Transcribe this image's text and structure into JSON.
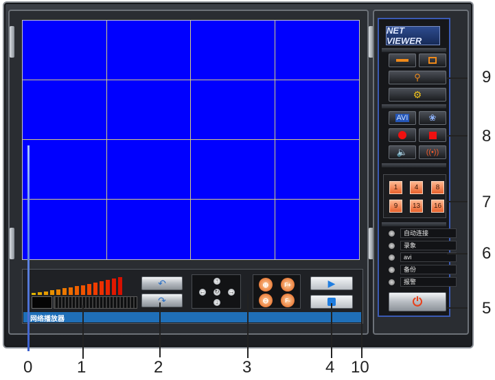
{
  "app": {
    "logo_text": "NET VIEWER",
    "status_bar_text": "网络播放器"
  },
  "status_panel": [
    {
      "label": "自动连接"
    },
    {
      "label": "录象"
    },
    {
      "label": "avi"
    },
    {
      "label": "备份"
    },
    {
      "label": "报警"
    }
  ],
  "channels": [
    "1",
    "4",
    "8",
    "9",
    "13",
    "16"
  ],
  "record_buttons": {
    "avi_label": "AVI"
  },
  "zoom_buttons": {
    "zoom_in": "⊕",
    "zoom_out": "⊖",
    "focus_plus": "F+",
    "focus_minus": "F-"
  },
  "callouts": [
    "0",
    "1",
    "2",
    "3",
    "4",
    "10",
    "5",
    "6",
    "7",
    "8",
    "9"
  ],
  "colors": {
    "video_bg": "#0000ff",
    "grid_line": "#d8d080",
    "status_bar": "#1f6fb8",
    "accent_orange": "#e8612c",
    "accent_blue": "#3b5bb5"
  },
  "icons": [
    "minimize-icon",
    "window-icon",
    "network-icon",
    "settings-gear-icon",
    "film-reel-icon",
    "record-icon",
    "stop-icon",
    "speaker-icon",
    "alarm-icon",
    "back-icon",
    "forward-icon",
    "play-icon",
    "stop-square-icon",
    "power-icon"
  ]
}
